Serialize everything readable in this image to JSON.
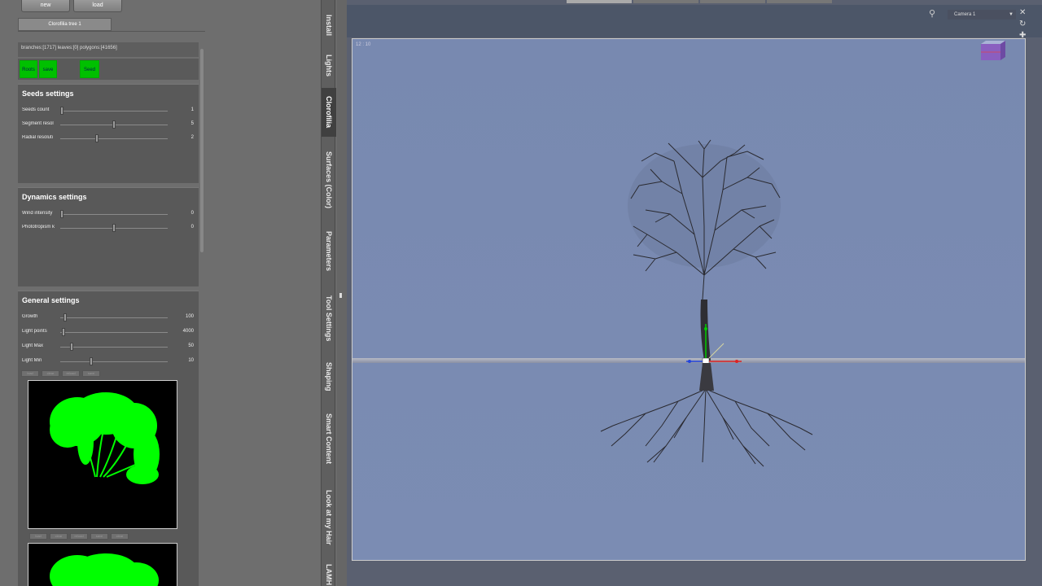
{
  "toolbar": {
    "new_label": "new",
    "load_label": "load"
  },
  "tree_tab": {
    "label": "Clorofilia tree 1"
  },
  "stats": {
    "text": "branches:[1717] leaves:[0] polygons:[41656]"
  },
  "action_buttons": [
    {
      "label": "Roots"
    },
    {
      "label": "save"
    },
    {
      "label": ""
    },
    {
      "label": "Seed"
    }
  ],
  "seeds": {
    "title": "Seeds settings",
    "sliders": [
      {
        "label": "Seeds count",
        "value": "1",
        "level": 0.0
      },
      {
        "label": "Segment resol",
        "value": "5",
        "level": 0.5
      },
      {
        "label": "Radial resoluti",
        "value": "2",
        "level": 0.33
      }
    ]
  },
  "dynamics": {
    "title": "Dynamics settings",
    "sliders": [
      {
        "label": "Wind intensity",
        "value": "0",
        "level": 0.0
      },
      {
        "label": "Phototropism k",
        "value": "0",
        "level": 0.5
      }
    ]
  },
  "general": {
    "title": "General settings",
    "sliders": [
      {
        "label": "Growth",
        "value": "100",
        "level": 0.03
      },
      {
        "label": "Light points",
        "value": "4000",
        "level": 0.02
      },
      {
        "label": "Light Max",
        "value": "50",
        "level": 0.1
      },
      {
        "label": "Light Min",
        "value": "10",
        "level": 0.28
      }
    ]
  },
  "mini_buttons": [
    "load",
    "clear",
    "reload",
    "save"
  ],
  "mini_buttons_2": [
    "load",
    "clear",
    "reload",
    "save",
    "clear"
  ],
  "vertical_tabs": [
    {
      "label": "Install"
    },
    {
      "label": "Lights"
    },
    {
      "label": "Clorofilia"
    },
    {
      "label": "Surfaces (Color)"
    },
    {
      "label": "Parameters"
    },
    {
      "label": "Tool Settings"
    },
    {
      "label": "Shaping"
    },
    {
      "label": "Smart Content"
    },
    {
      "label": "Look at my Hair"
    },
    {
      "label": "LAMH"
    }
  ],
  "viewport": {
    "camera_label": "Camera 1",
    "coords": "12 : 10"
  },
  "colors": {
    "viewport_bg": "#7889b0",
    "preview_green": "#00ff00",
    "action_green": "#00c000"
  }
}
